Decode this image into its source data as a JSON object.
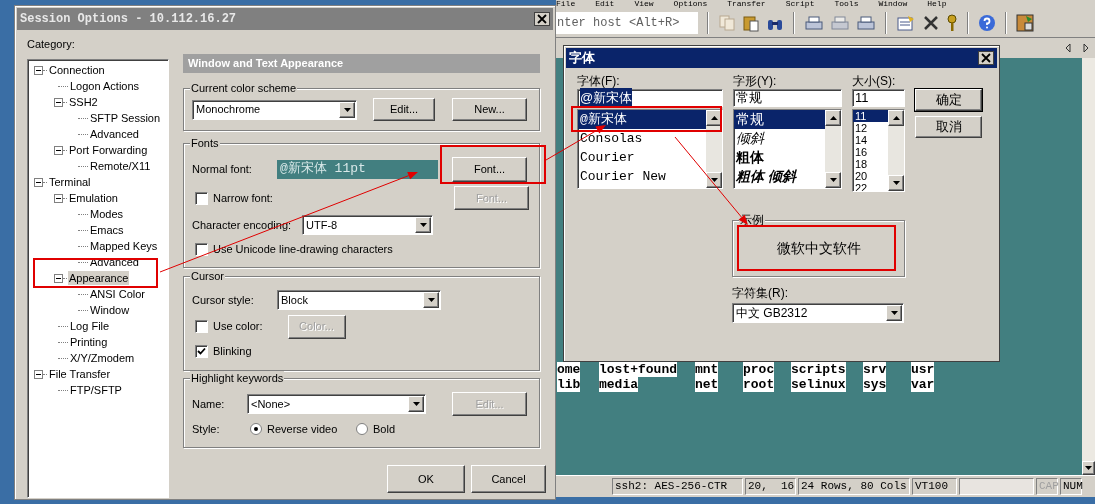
{
  "app": {
    "menu": [
      "File",
      "Edit",
      "View",
      "Options",
      "Transfer",
      "Script",
      "Tools",
      "Window",
      "Help"
    ],
    "host_field": {
      "placeholder": "nter host <Alt+R>"
    },
    "terminal": {
      "rows": [
        [
          "ome",
          "lost+found",
          "mnt",
          "proc",
          "scripts",
          "srv",
          "usr"
        ],
        [
          "lib",
          "media",
          "net",
          "root",
          "selinux",
          "sys",
          "var"
        ]
      ]
    },
    "status_bar": [
      {
        "kind": "text",
        "text": "ssh2: AES-256-CTR",
        "disabled": false
      },
      {
        "kind": "text",
        "text": "20,  16",
        "disabled": false
      },
      {
        "kind": "text",
        "text": "24 Rows, 80 Cols",
        "disabled": false
      },
      {
        "kind": "text",
        "text": "VT100",
        "disabled": false
      },
      {
        "kind": "blank"
      },
      {
        "kind": "text",
        "text": "CAP",
        "disabled": true
      },
      {
        "kind": "text",
        "text": "NUM",
        "disabled": false
      }
    ]
  },
  "session_options": {
    "title": "Session Options - 10.112.16.27",
    "category_label": "Category:",
    "tree": [
      {
        "label": "Connection",
        "expanded": true,
        "selected": false,
        "children": [
          {
            "label": "Logon Actions",
            "selected": false
          },
          {
            "label": "SSH2",
            "expanded": true,
            "selected": false,
            "children": [
              {
                "label": "SFTP Session",
                "selected": false
              },
              {
                "label": "Advanced",
                "selected": false
              }
            ]
          },
          {
            "label": "Port Forwarding",
            "expanded": true,
            "selected": false,
            "children": [
              {
                "label": "Remote/X11",
                "selected": false
              }
            ]
          }
        ]
      },
      {
        "label": "Terminal",
        "expanded": true,
        "selected": false,
        "children": [
          {
            "label": "Emulation",
            "expanded": true,
            "selected": false,
            "children": [
              {
                "label": "Modes",
                "selected": false
              },
              {
                "label": "Emacs",
                "selected": false
              },
              {
                "label": "Mapped Keys",
                "selected": false
              },
              {
                "label": "Advanced",
                "selected": false
              }
            ]
          },
          {
            "label": "Appearance",
            "expanded": true,
            "selected": true,
            "children": [
              {
                "label": "ANSI Color",
                "selected": false
              },
              {
                "label": "Window",
                "selected": false
              }
            ]
          },
          {
            "label": "Log File",
            "selected": false
          },
          {
            "label": "Printing",
            "selected": false
          },
          {
            "label": "X/Y/Zmodem",
            "selected": false
          }
        ]
      },
      {
        "label": "File Transfer",
        "expanded": true,
        "selected": false,
        "children": [
          {
            "label": "FTP/SFTP",
            "selected": false
          }
        ]
      }
    ],
    "header": "Window and Text Appearance",
    "color_scheme": {
      "title": "Current color scheme",
      "value": "Monochrome",
      "buttons": [
        {
          "label": "Edit...",
          "disabled": false
        },
        {
          "label": "New...",
          "disabled": false
        }
      ]
    },
    "fonts": {
      "title": "Fonts",
      "normal_font_label": "Normal font:",
      "normal_font_value": "@新宋体 11pt",
      "font_button": {
        "label": "Font...",
        "disabled": false
      },
      "narrow_font": {
        "label": "Narrow font:",
        "checked": false
      },
      "narrow_font_button": {
        "label": "Font...",
        "disabled": true
      },
      "encoding_label": "Character encoding:",
      "encoding_value": "UTF-8",
      "unicode_line": {
        "label": "Use Unicode line-drawing characters",
        "checked": false
      }
    },
    "cursor": {
      "title": "Cursor",
      "style_label": "Cursor style:",
      "style_value": "Block",
      "use_color": {
        "label": "Use color:",
        "checked": false
      },
      "color_button": {
        "label": "Color...",
        "disabled": true
      },
      "blinking": {
        "label": "Blinking",
        "checked": true
      }
    },
    "highlight": {
      "title": "Highlight keywords",
      "name_label": "Name:",
      "name_value": "<None>",
      "edit_button": {
        "label": "Edit...",
        "disabled": true
      },
      "style_label": "Style:",
      "options": [
        {
          "label": "Reverse video",
          "selected": true
        },
        {
          "label": "Bold",
          "selected": false
        }
      ]
    },
    "buttons": [
      "OK",
      "Cancel"
    ]
  },
  "font_dialog": {
    "title": "字体",
    "font": {
      "label": "字体(F):",
      "value": "@新宋体",
      "items": [
        {
          "label": "@新宋体",
          "selected": true
        },
        {
          "label": "Consolas",
          "selected": false
        },
        {
          "label": "Courier",
          "selected": false
        },
        {
          "label": "Courier New",
          "selected": false
        }
      ]
    },
    "style": {
      "label": "字形(Y):",
      "value": "常规",
      "items": [
        {
          "label": "常规",
          "kind": "regular",
          "selected": true
        },
        {
          "label": "倾斜",
          "kind": "italic",
          "selected": false
        },
        {
          "label": "粗体",
          "kind": "bold",
          "selected": false
        },
        {
          "label": "粗体 倾斜",
          "kind": "bold-italic",
          "selected": false
        }
      ]
    },
    "size": {
      "label": "大小(S):",
      "value": "11",
      "items": [
        {
          "label": "11",
          "selected": true
        },
        {
          "label": "12",
          "selected": false
        },
        {
          "label": "14",
          "selected": false
        },
        {
          "label": "16",
          "selected": false
        },
        {
          "label": "18",
          "selected": false
        },
        {
          "label": "20",
          "selected": false
        },
        {
          "label": "22",
          "selected": false
        }
      ]
    },
    "buttons": [
      "确定",
      "取消"
    ],
    "sample": {
      "title": "示例",
      "text": "微软中文软件"
    },
    "charset": {
      "label": "字符集(R):",
      "value": "中文 GB2312"
    }
  }
}
